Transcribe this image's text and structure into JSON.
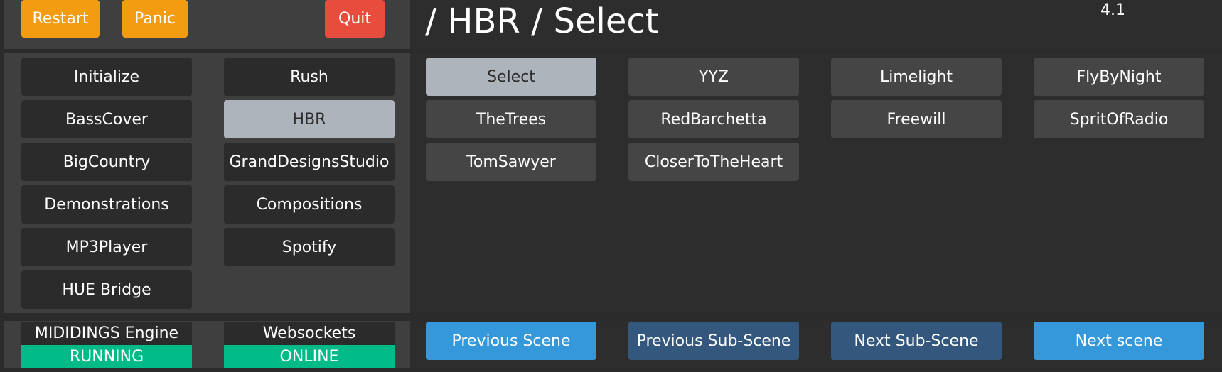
{
  "header": {
    "restart_label": "Restart",
    "panic_label": "Panic",
    "quit_label": "Quit",
    "title": "/ HBR / Select",
    "version": "4.1"
  },
  "sidebar": {
    "items": [
      {
        "label": "Initialize",
        "active": false
      },
      {
        "label": "Rush",
        "active": false
      },
      {
        "label": "BassCover",
        "active": false
      },
      {
        "label": "HBR",
        "active": true
      },
      {
        "label": "BigCountry",
        "active": false
      },
      {
        "label": "GrandDesignsStudio",
        "active": false
      },
      {
        "label": "Demonstrations",
        "active": false
      },
      {
        "label": "Compositions",
        "active": false
      },
      {
        "label": "MP3Player",
        "active": false
      },
      {
        "label": "Spotify",
        "active": false
      },
      {
        "label": "HUE Bridge",
        "active": false
      }
    ]
  },
  "scenes": {
    "items": [
      {
        "label": "Select",
        "active": true
      },
      {
        "label": "YYZ",
        "active": false
      },
      {
        "label": "Limelight",
        "active": false
      },
      {
        "label": "FlyByNight",
        "active": false
      },
      {
        "label": "TheTrees",
        "active": false
      },
      {
        "label": "RedBarchetta",
        "active": false
      },
      {
        "label": "Freewill",
        "active": false
      },
      {
        "label": "SpritOfRadio",
        "active": false
      },
      {
        "label": "TomSawyer",
        "active": false
      },
      {
        "label": "CloserToTheHeart",
        "active": false
      }
    ]
  },
  "status": {
    "engine_label": "MIDIDINGS Engine",
    "engine_value": "RUNNING",
    "websockets_label": "Websockets",
    "websockets_value": "ONLINE"
  },
  "footer": {
    "prev_scene_label": "Previous Scene",
    "prev_subscene_label": "Previous Sub-Scene",
    "next_subscene_label": "Next Sub-Scene",
    "next_scene_label": "Next scene"
  },
  "colors": {
    "orange": "#f39c12",
    "red": "#e74c3c",
    "active_button": "#aeb4bc",
    "status_green": "#00bb88",
    "blue_light": "#3498db",
    "blue_dark": "#34587d"
  }
}
